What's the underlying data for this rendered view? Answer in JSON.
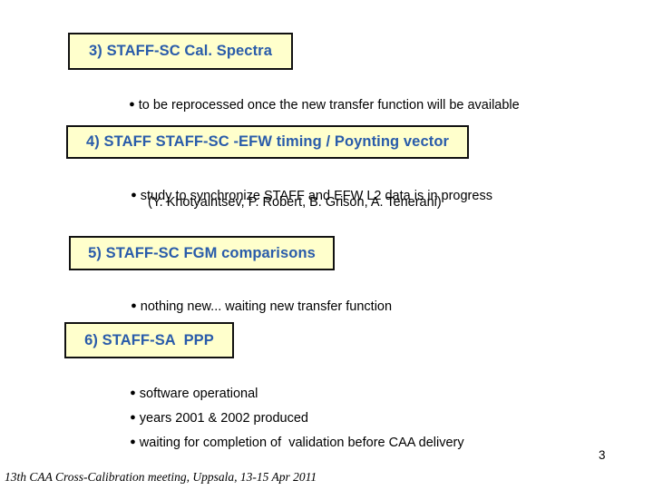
{
  "slide": {
    "page_number": "3",
    "footer": "13th CAA Cross-Calibration meeting, Uppsala, 13-15 Apr 2011",
    "colors": {
      "heading_fill": "#ffffcc",
      "heading_border": "#111111",
      "heading_text": "#2a5caa",
      "body_text": "#000000",
      "background": "#ffffff"
    },
    "bullet_glyph": "●",
    "sections": [
      {
        "heading": "3) STAFF-SC Cal. Spectra",
        "bullets": [
          "to be reprocessed once the new transfer function will be available"
        ]
      },
      {
        "heading": "4) STAFF STAFF-SC -EFW timing / Poynting vector",
        "bullets": [
          "study to synchronize STAFF and EFW L2 data is in progress"
        ],
        "subline": "(Y. Khotyaintsev, P. Robert, B. Grison, A. Tenerani)"
      },
      {
        "heading": "5) STAFF-SC FGM comparisons",
        "bullets": [
          "nothing new... waiting new transfer function"
        ]
      },
      {
        "heading": "6) STAFF-SA  PPP",
        "bullets": [
          "software operational",
          "years 2001 & 2002 produced",
          "waiting for completion of  validation before CAA delivery"
        ]
      }
    ]
  }
}
